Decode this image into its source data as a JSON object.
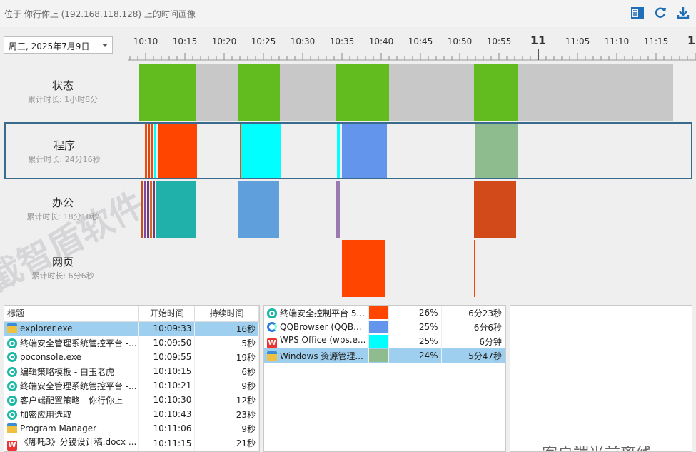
{
  "header": {
    "title": "位于 你行你上 (192.168.118.128) 上的时间画像",
    "icons": [
      "panel-toggle-icon",
      "refresh-icon",
      "download-icon"
    ]
  },
  "date_select": {
    "value": "周三, 2025年7月9日"
  },
  "ruler": {
    "labels": [
      "10:10",
      "10:15",
      "10:20",
      "10:25",
      "10:30",
      "10:35",
      "10:40",
      "10:45",
      "10:50",
      "10:55",
      "11",
      "11:05",
      "11:10",
      "11:15",
      "11"
    ]
  },
  "rows": [
    {
      "name": "状态",
      "total": "累计时长: 1小时8分",
      "segments": [
        {
          "start_min": 0.0,
          "end_min": 7.3,
          "color": "#62bb1f"
        },
        {
          "start_min": 7.3,
          "end_min": 12.6,
          "color": "#c8c8c8"
        },
        {
          "start_min": 12.6,
          "end_min": 17.9,
          "color": "#62bb1f"
        },
        {
          "start_min": 17.9,
          "end_min": 25.0,
          "color": "#c8c8c8"
        },
        {
          "start_min": 25.0,
          "end_min": 31.8,
          "color": "#62bb1f"
        },
        {
          "start_min": 31.8,
          "end_min": 42.6,
          "color": "#c8c8c8"
        },
        {
          "start_min": 42.6,
          "end_min": 48.3,
          "color": "#62bb1f"
        },
        {
          "start_min": 48.3,
          "end_min": 68.0,
          "color": "#c8c8c8"
        }
      ]
    },
    {
      "name": "程序",
      "total": "累计时长: 24分16秒",
      "segments": [
        {
          "start_min": 0.5,
          "end_min": 0.8,
          "color": "#ff4500"
        },
        {
          "start_min": 0.9,
          "end_min": 1.2,
          "color": "#d24a1a"
        },
        {
          "start_min": 1.3,
          "end_min": 1.6,
          "color": "#ff4500"
        },
        {
          "start_min": 1.7,
          "end_min": 2.0,
          "color": "#00ffff"
        },
        {
          "start_min": 2.2,
          "end_min": 7.2,
          "color": "#ff4500"
        },
        {
          "start_min": 12.6,
          "end_min": 12.8,
          "color": "#ff4500"
        },
        {
          "start_min": 12.8,
          "end_min": 17.8,
          "color": "#00ffff"
        },
        {
          "start_min": 25.0,
          "end_min": 25.4,
          "color": "#00ffff"
        },
        {
          "start_min": 25.6,
          "end_min": 31.4,
          "color": "#6495ed"
        },
        {
          "start_min": 42.6,
          "end_min": 48.0,
          "color": "#8fbc8f"
        }
      ]
    },
    {
      "name": "办公",
      "total": "累计时长: 18分10秒",
      "segments": [
        {
          "start_min": 0.3,
          "end_min": 0.5,
          "color": "#d24a1a"
        },
        {
          "start_min": 0.6,
          "end_min": 0.9,
          "color": "#7d4a9e"
        },
        {
          "start_min": 1.0,
          "end_min": 1.3,
          "color": "#6a3b7e"
        },
        {
          "start_min": 1.4,
          "end_min": 1.6,
          "color": "#d2691e"
        },
        {
          "start_min": 1.7,
          "end_min": 2.0,
          "color": "#6a3b7e"
        },
        {
          "start_min": 2.2,
          "end_min": 7.2,
          "color": "#20b2aa"
        },
        {
          "start_min": 12.6,
          "end_min": 17.8,
          "color": "#5f9fdc"
        },
        {
          "start_min": 25.0,
          "end_min": 25.5,
          "color": "#9a7ab0"
        },
        {
          "start_min": 42.6,
          "end_min": 48.0,
          "color": "#d24a1a"
        }
      ]
    },
    {
      "name": "网页",
      "total": "累计时长: 6分6秒",
      "segments": [
        {
          "start_min": 25.8,
          "end_min": 31.4,
          "color": "#ff4500"
        },
        {
          "start_min": 42.6,
          "end_min": 42.8,
          "color": "#ff4500"
        }
      ]
    }
  ],
  "events_table": {
    "columns": [
      "标题",
      "开始时间",
      "持续时间"
    ],
    "rows": [
      {
        "icon": "folder",
        "title": "explorer.exe",
        "start": "10:09:33",
        "duration": "16秒",
        "selected": true
      },
      {
        "icon": "teal",
        "title": "终端安全管理系统管控平台 -...",
        "start": "10:09:50",
        "duration": "5秒"
      },
      {
        "icon": "teal",
        "title": "poconsole.exe",
        "start": "10:09:55",
        "duration": "19秒"
      },
      {
        "icon": "teal",
        "title": "编辑策略模板 - 白玉老虎",
        "start": "10:10:15",
        "duration": "6秒"
      },
      {
        "icon": "teal",
        "title": "终端安全管理系统管控平台 -...",
        "start": "10:10:21",
        "duration": "9秒"
      },
      {
        "icon": "teal",
        "title": "客户端配置策略 - 你行你上",
        "start": "10:10:30",
        "duration": "12秒"
      },
      {
        "icon": "teal",
        "title": "加密应用选取",
        "start": "10:10:43",
        "duration": "23秒"
      },
      {
        "icon": "folder",
        "title": "Program Manager",
        "start": "10:11:06",
        "duration": "9秒"
      },
      {
        "icon": "wps",
        "title": "《哪吒3》分镜设计稿.docx ...",
        "start": "10:11:15",
        "duration": "21秒"
      }
    ]
  },
  "programs_table": {
    "rows": [
      {
        "icon": "teal",
        "name": "终端安全控制平台 5...",
        "color": "#ff4500",
        "percent": "26%",
        "duration": "6分23秒"
      },
      {
        "icon": "qq",
        "name": "QQBrowser (QQB...",
        "color": "#6495ed",
        "percent": "25%",
        "duration": "6分6秒"
      },
      {
        "icon": "wps",
        "name": "WPS Office (wps.e...",
        "color": "#00ffff",
        "percent": "25%",
        "duration": "6分钟"
      },
      {
        "icon": "folder",
        "name": "Windows 资源管理...",
        "color": "#8fbc8f",
        "percent": "24%",
        "duration": "5分47秒",
        "selected": true
      }
    ]
  },
  "status_panel": {
    "text": "客户端当前离线"
  },
  "watermark": "截智盾软件"
}
